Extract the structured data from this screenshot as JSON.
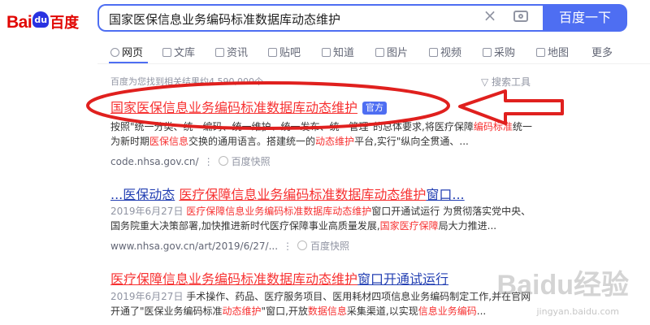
{
  "logo": {
    "part1": "Bai",
    "paw": "du",
    "part2": "百度"
  },
  "search": {
    "query": "国家医保信息业务编码标准数据库动态维护",
    "button": "百度一下"
  },
  "tabs": [
    {
      "label": "网页",
      "icon": "search-icon"
    },
    {
      "label": "文库",
      "icon": "doc-icon"
    },
    {
      "label": "资讯",
      "icon": "news-icon"
    },
    {
      "label": "贴吧",
      "icon": "tieba-icon"
    },
    {
      "label": "知道",
      "icon": "zhidao-icon"
    },
    {
      "label": "图片",
      "icon": "image-icon"
    },
    {
      "label": "视频",
      "icon": "video-icon"
    },
    {
      "label": "采购",
      "icon": "cart-icon"
    },
    {
      "label": "地图",
      "icon": "map-icon"
    },
    {
      "label": "更多",
      "icon": ""
    }
  ],
  "result_count": "百度为您找到相关结果约4,590,000个",
  "tools": "搜索工具",
  "results": [
    {
      "title": "国家医保信息业务编码标准数据库动态维护",
      "badge": "官方",
      "snippet1_a": "按照\"统一分类、统一编码、统一维护、统一发布、统一管理\"的总体要求,将医疗保障",
      "snippet1_hl": "编码标准",
      "snippet1_b": "统一",
      "snippet2_a": "为新时期",
      "snippet2_hl": "医保信息",
      "snippet2_b": "交换的通用语言。搭建统一的",
      "snippet2_hl2": "动态维护",
      "snippet2_c": "平台,实行\"纵向全贯通、...",
      "url": "code.nhsa.gov.cn/",
      "snapshot": "百度快照"
    },
    {
      "title_a": "...医保动态",
      "title_b": "医疗保障信息业务编码标准数据库动态维护",
      "title_c": "窗口...",
      "date": "2019年6月27日",
      "snippet1_hl": "医疗保障信息业务编码标准数据库动态维护",
      "snippet1_b": "窗口开通试运行 为贯彻落实党中央、",
      "snippet2_a": "国务院重大决策部署,加快推进新时代医疗保障事业高质量发展,",
      "snippet2_hl": "国家医疗保障",
      "snippet2_b": "局大力推进...",
      "url": "www.nhsa.gov.cn/art/2019/6/27/...",
      "snapshot": "百度快照"
    },
    {
      "title_a": "医疗保障信息业务编码标准数据库动态维护",
      "title_b": "窗口开通试运行",
      "date": "2019年6月27日",
      "snippet1_b": "手术操作、药品、医疗服务项目、医用耗材四项信息业务编码制定工作,并在官网",
      "snippet2_a": "开通了\"医保业务编码标准",
      "snippet2_hl": "动态维护",
      "snippet2_b": "\"窗口,开放",
      "snippet2_hl2": "数据信息",
      "snippet2_c": "采集渠道,以实现",
      "snippet2_hl3": "信息业务编码",
      "snippet2_d": "..."
    }
  ],
  "watermark": {
    "main": "Baidu经验",
    "sub": "jingyan.baidu.com"
  },
  "annotation_color": "#e0201e"
}
